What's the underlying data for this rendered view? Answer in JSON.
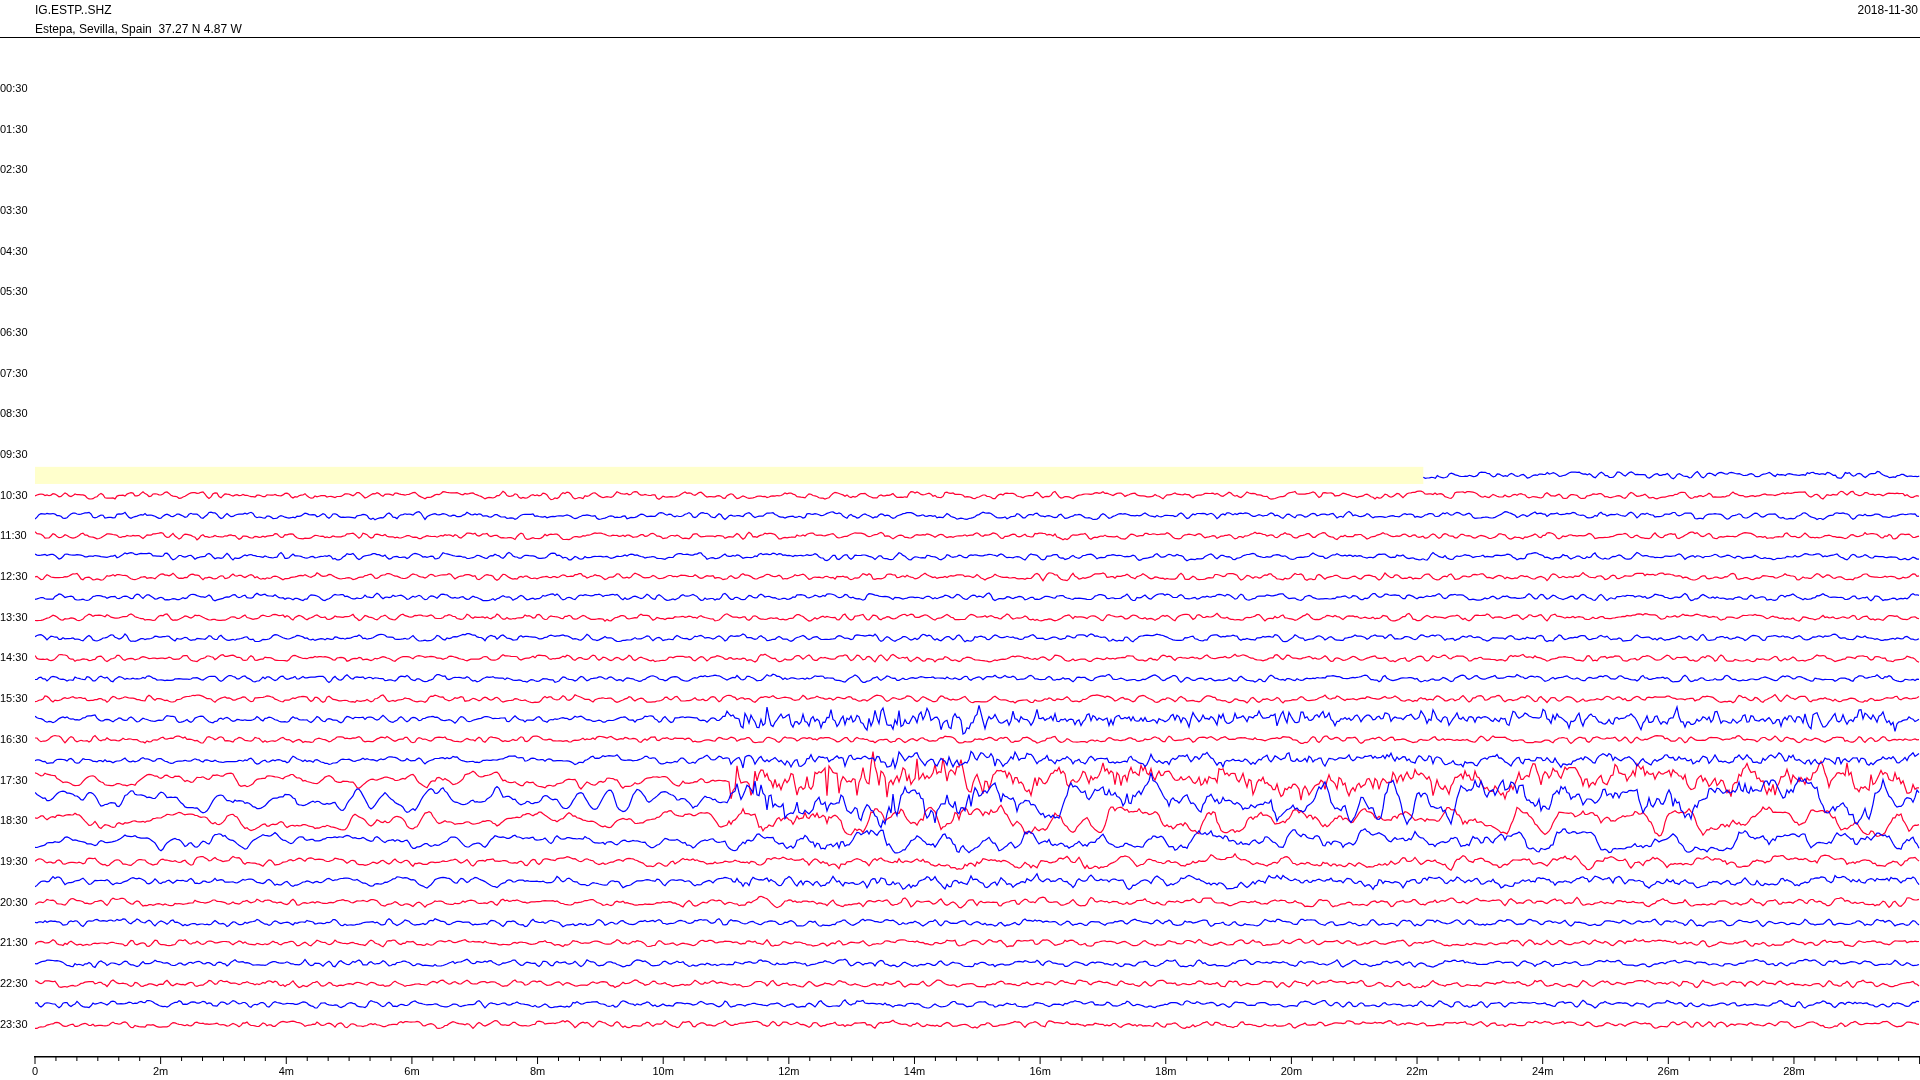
{
  "header": {
    "station": "IG.ESTP..SHZ",
    "location": "Estepa, Sevilla, Spain  37.27 N 4.87 W",
    "date": "2018-11-30"
  },
  "hour_labels": [
    "00:30",
    "01:30",
    "02:30",
    "03:30",
    "04:30",
    "05:30",
    "06:30",
    "07:30",
    "08:30",
    "09:30",
    "10:30",
    "11:30",
    "12:30",
    "13:30",
    "14:30",
    "15:30",
    "16:30",
    "17:30",
    "18:30",
    "19:30",
    "20:30",
    "21:30",
    "22:30",
    "23:30"
  ],
  "x_axis_labels": [
    "0",
    "2m",
    "4m",
    "6m",
    "8m",
    "10m",
    "12m",
    "14m",
    "16m",
    "18m",
    "20m",
    "22m",
    "24m",
    "26m",
    "28m"
  ]
}
